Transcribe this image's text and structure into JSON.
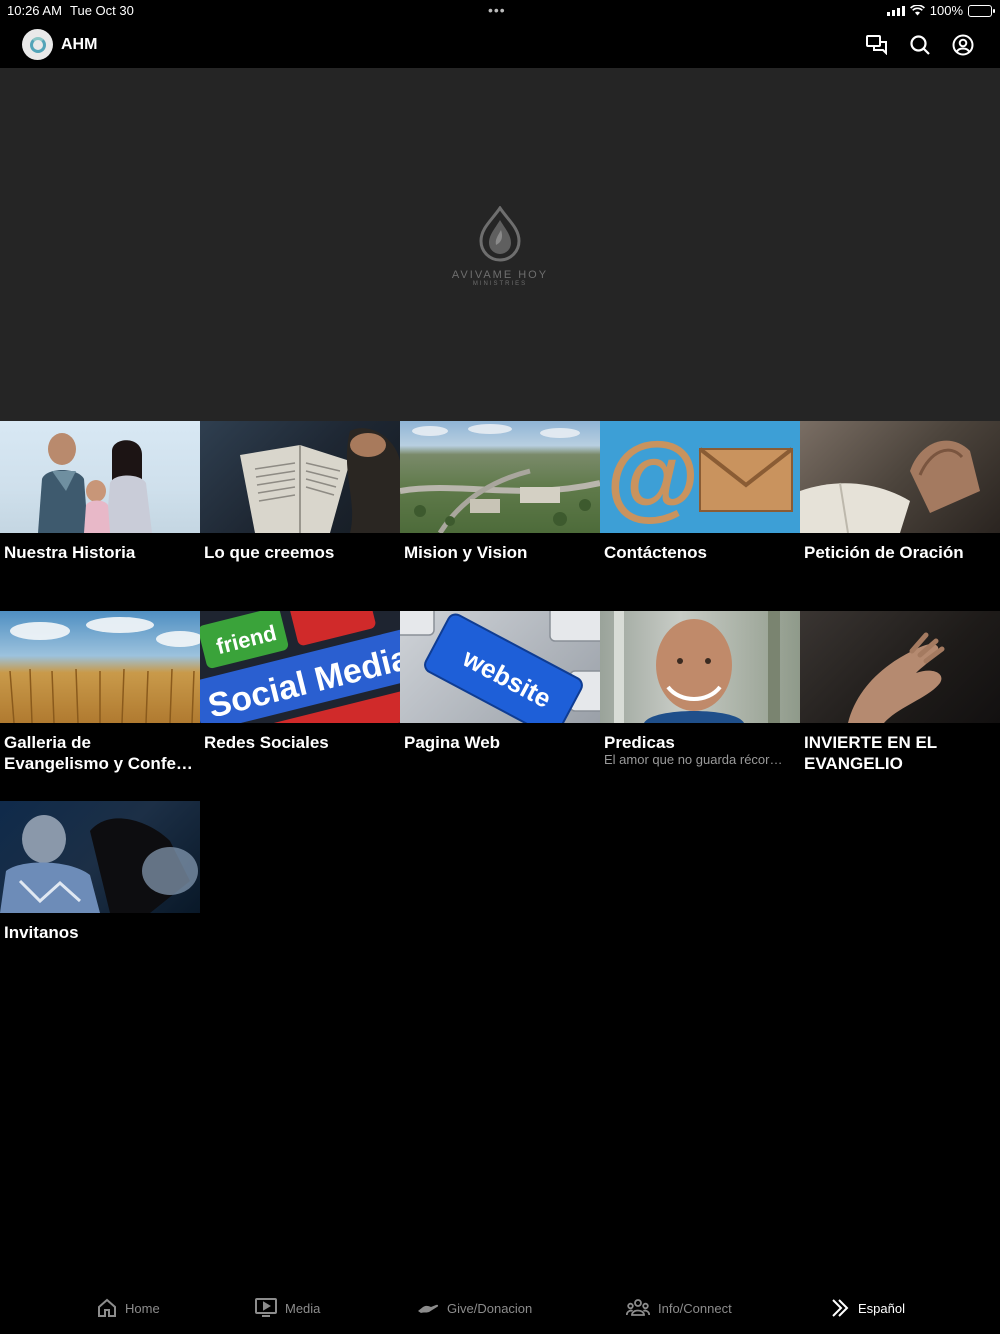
{
  "status": {
    "time": "10:26 AM",
    "date": "Tue Oct 30",
    "battery": "100%"
  },
  "header": {
    "app_title": "AHM"
  },
  "hero": {
    "brand": "AVIVAME HOY",
    "sub": "MINISTRIES"
  },
  "tiles": [
    {
      "title": "Nuestra Historia",
      "subtitle": ""
    },
    {
      "title": "Lo que creemos",
      "subtitle": ""
    },
    {
      "title": "Mision y Vision",
      "subtitle": ""
    },
    {
      "title": "Contáctenos",
      "subtitle": ""
    },
    {
      "title": "Petición de Oración",
      "subtitle": ""
    },
    {
      "title": "Galleria de Evangelismo y Confe…",
      "subtitle": ""
    },
    {
      "title": "Redes Sociales",
      "subtitle": ""
    },
    {
      "title": "Pagina Web",
      "subtitle": ""
    },
    {
      "title": "Predicas",
      "subtitle": "El amor que no guarda récor…"
    },
    {
      "title": "INVIERTE EN EL EVANGELIO",
      "subtitle": ""
    },
    {
      "title": "Invitanos",
      "subtitle": ""
    }
  ],
  "thumb_text": {
    "friend": "friend",
    "social": "Social Media",
    "website": "website"
  },
  "tabs": [
    {
      "label": "Home",
      "icon": "home-icon"
    },
    {
      "label": "Media",
      "icon": "media-icon"
    },
    {
      "label": "Give/Donacion",
      "icon": "give-icon"
    },
    {
      "label": "Info/Connect",
      "icon": "people-icon"
    },
    {
      "label": "Español",
      "icon": "chevrons-right-icon"
    }
  ],
  "colors": {
    "background": "#000000",
    "hero": "#252525",
    "tab_inactive": "#8c8c8c",
    "tab_active": "#ffffff"
  }
}
